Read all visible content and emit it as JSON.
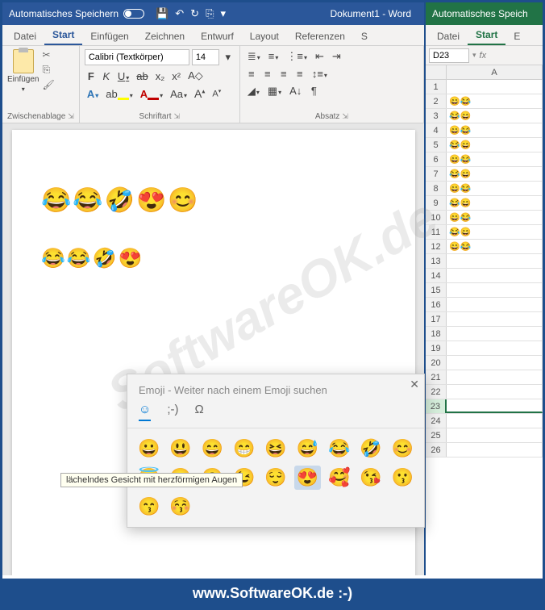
{
  "word": {
    "title_autosave": "Automatisches Speichern",
    "doc_name": "Dokument1 - Word",
    "tabs": [
      "Datei",
      "Start",
      "Einfügen",
      "Zeichnen",
      "Entwurf",
      "Layout",
      "Referenzen",
      "S"
    ],
    "active_tab": 1,
    "ribbon": {
      "clipboard": {
        "paste": "Einfügen",
        "label": "Zwischenablage"
      },
      "font": {
        "name": "Calibri (Textkörper)",
        "size": "14",
        "label": "Schriftart",
        "buttons": {
          "bold": "F",
          "italic": "K",
          "underline": "U",
          "strike": "ab",
          "sub": "x₂",
          "sup": "x²",
          "clear": "A",
          "effects": "A",
          "highlight": "ab",
          "color": "A",
          "case": "Aa",
          "grow": "A",
          "shrink": "A"
        },
        "highlight_color": "#ffff00",
        "font_color": "#c00000",
        "effects_color": "#2e75b6"
      },
      "paragraph": {
        "label": "Absatz"
      }
    },
    "doc_emojis_line1": "😂😂🤣😍😊",
    "doc_emojis_line2": "😂😂🤣😍"
  },
  "excel": {
    "title_autosave": "Automatisches Speich",
    "tabs": [
      "Datei",
      "Start",
      "E"
    ],
    "active_tab": 1,
    "name_box": "D23",
    "columns": [
      "A"
    ],
    "rows": [
      {
        "n": 1,
        "a": ""
      },
      {
        "n": 2,
        "a": "😄😂"
      },
      {
        "n": 3,
        "a": "😂😄"
      },
      {
        "n": 4,
        "a": "😄😂"
      },
      {
        "n": 5,
        "a": "😂😄"
      },
      {
        "n": 6,
        "a": "😄😂"
      },
      {
        "n": 7,
        "a": "😂😄"
      },
      {
        "n": 8,
        "a": "😄😂"
      },
      {
        "n": 9,
        "a": "😂😄"
      },
      {
        "n": 10,
        "a": "😄😂"
      },
      {
        "n": 11,
        "a": "😂😄"
      },
      {
        "n": 12,
        "a": "😄😂"
      },
      {
        "n": 13,
        "a": ""
      },
      {
        "n": 14,
        "a": ""
      },
      {
        "n": 15,
        "a": ""
      },
      {
        "n": 16,
        "a": ""
      },
      {
        "n": 17,
        "a": ""
      },
      {
        "n": 18,
        "a": ""
      },
      {
        "n": 19,
        "a": ""
      },
      {
        "n": 20,
        "a": ""
      },
      {
        "n": 21,
        "a": ""
      },
      {
        "n": 22,
        "a": ""
      },
      {
        "n": 23,
        "a": ""
      },
      {
        "n": 24,
        "a": ""
      },
      {
        "n": 25,
        "a": ""
      },
      {
        "n": 26,
        "a": ""
      }
    ],
    "selected_row": 23
  },
  "emoji_panel": {
    "search_placeholder": "Emoji - Weiter nach einem Emoji suchen",
    "tabs": {
      "emoji": "☺",
      "kaomoji": ";-)",
      "symbols": "Ω"
    },
    "tooltip": "lächelndes Gesicht mit herzförmigen Augen",
    "grid": [
      "😀",
      "😃",
      "😄",
      "😁",
      "😆",
      "😅",
      "😂",
      "🤣",
      "😊",
      "😇",
      "🙂",
      "🙃",
      "😉",
      "😌",
      "😍",
      "🥰",
      "😘",
      "😗",
      "😙",
      "😚"
    ],
    "selected_index": 14
  },
  "watermark": "SoftwareOK.de",
  "footer": "www.SoftwareOK.de :-)"
}
